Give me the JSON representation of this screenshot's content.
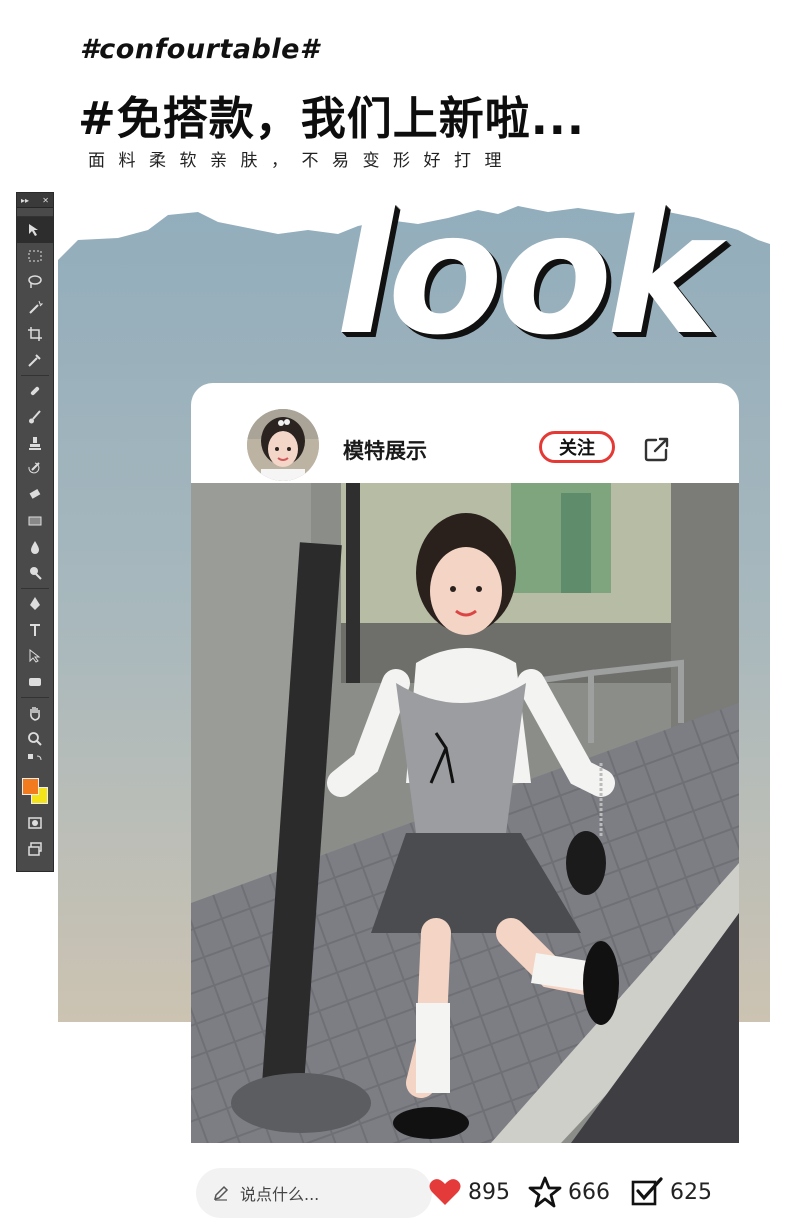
{
  "header": {
    "hashtag": "#confourtable#",
    "headline": "#免搭款，我们上新啦...",
    "subline": "面料柔软亲肤，不易变形好打理"
  },
  "decor": {
    "big_word": "look"
  },
  "toolbar": {
    "collapse": "▸▸",
    "close": "✕",
    "tools": [
      "move-tool",
      "marquee-tool",
      "lasso-tool",
      "magic-wand-tool",
      "crop-tool",
      "eyedropper-tool",
      "healing-tool",
      "brush-tool",
      "stamp-tool",
      "history-brush-tool",
      "eraser-tool",
      "gradient-tool",
      "blur-tool",
      "dodge-tool",
      "pen-tool",
      "type-tool",
      "path-select-tool",
      "shape-tool",
      "hand-tool",
      "zoom-tool"
    ],
    "colors": {
      "foreground": "#f27a1f",
      "background": "#f5e31a"
    }
  },
  "post": {
    "username": "模特展示",
    "follow_label": "关注"
  },
  "bottom_bar": {
    "comment_placeholder": "说点什么...",
    "likes": "895",
    "favorites": "666",
    "shares": "625"
  },
  "colors": {
    "accent_red": "#e53935",
    "sky_top": "#93aebd",
    "sky_bottom": "#c9c2b2"
  }
}
